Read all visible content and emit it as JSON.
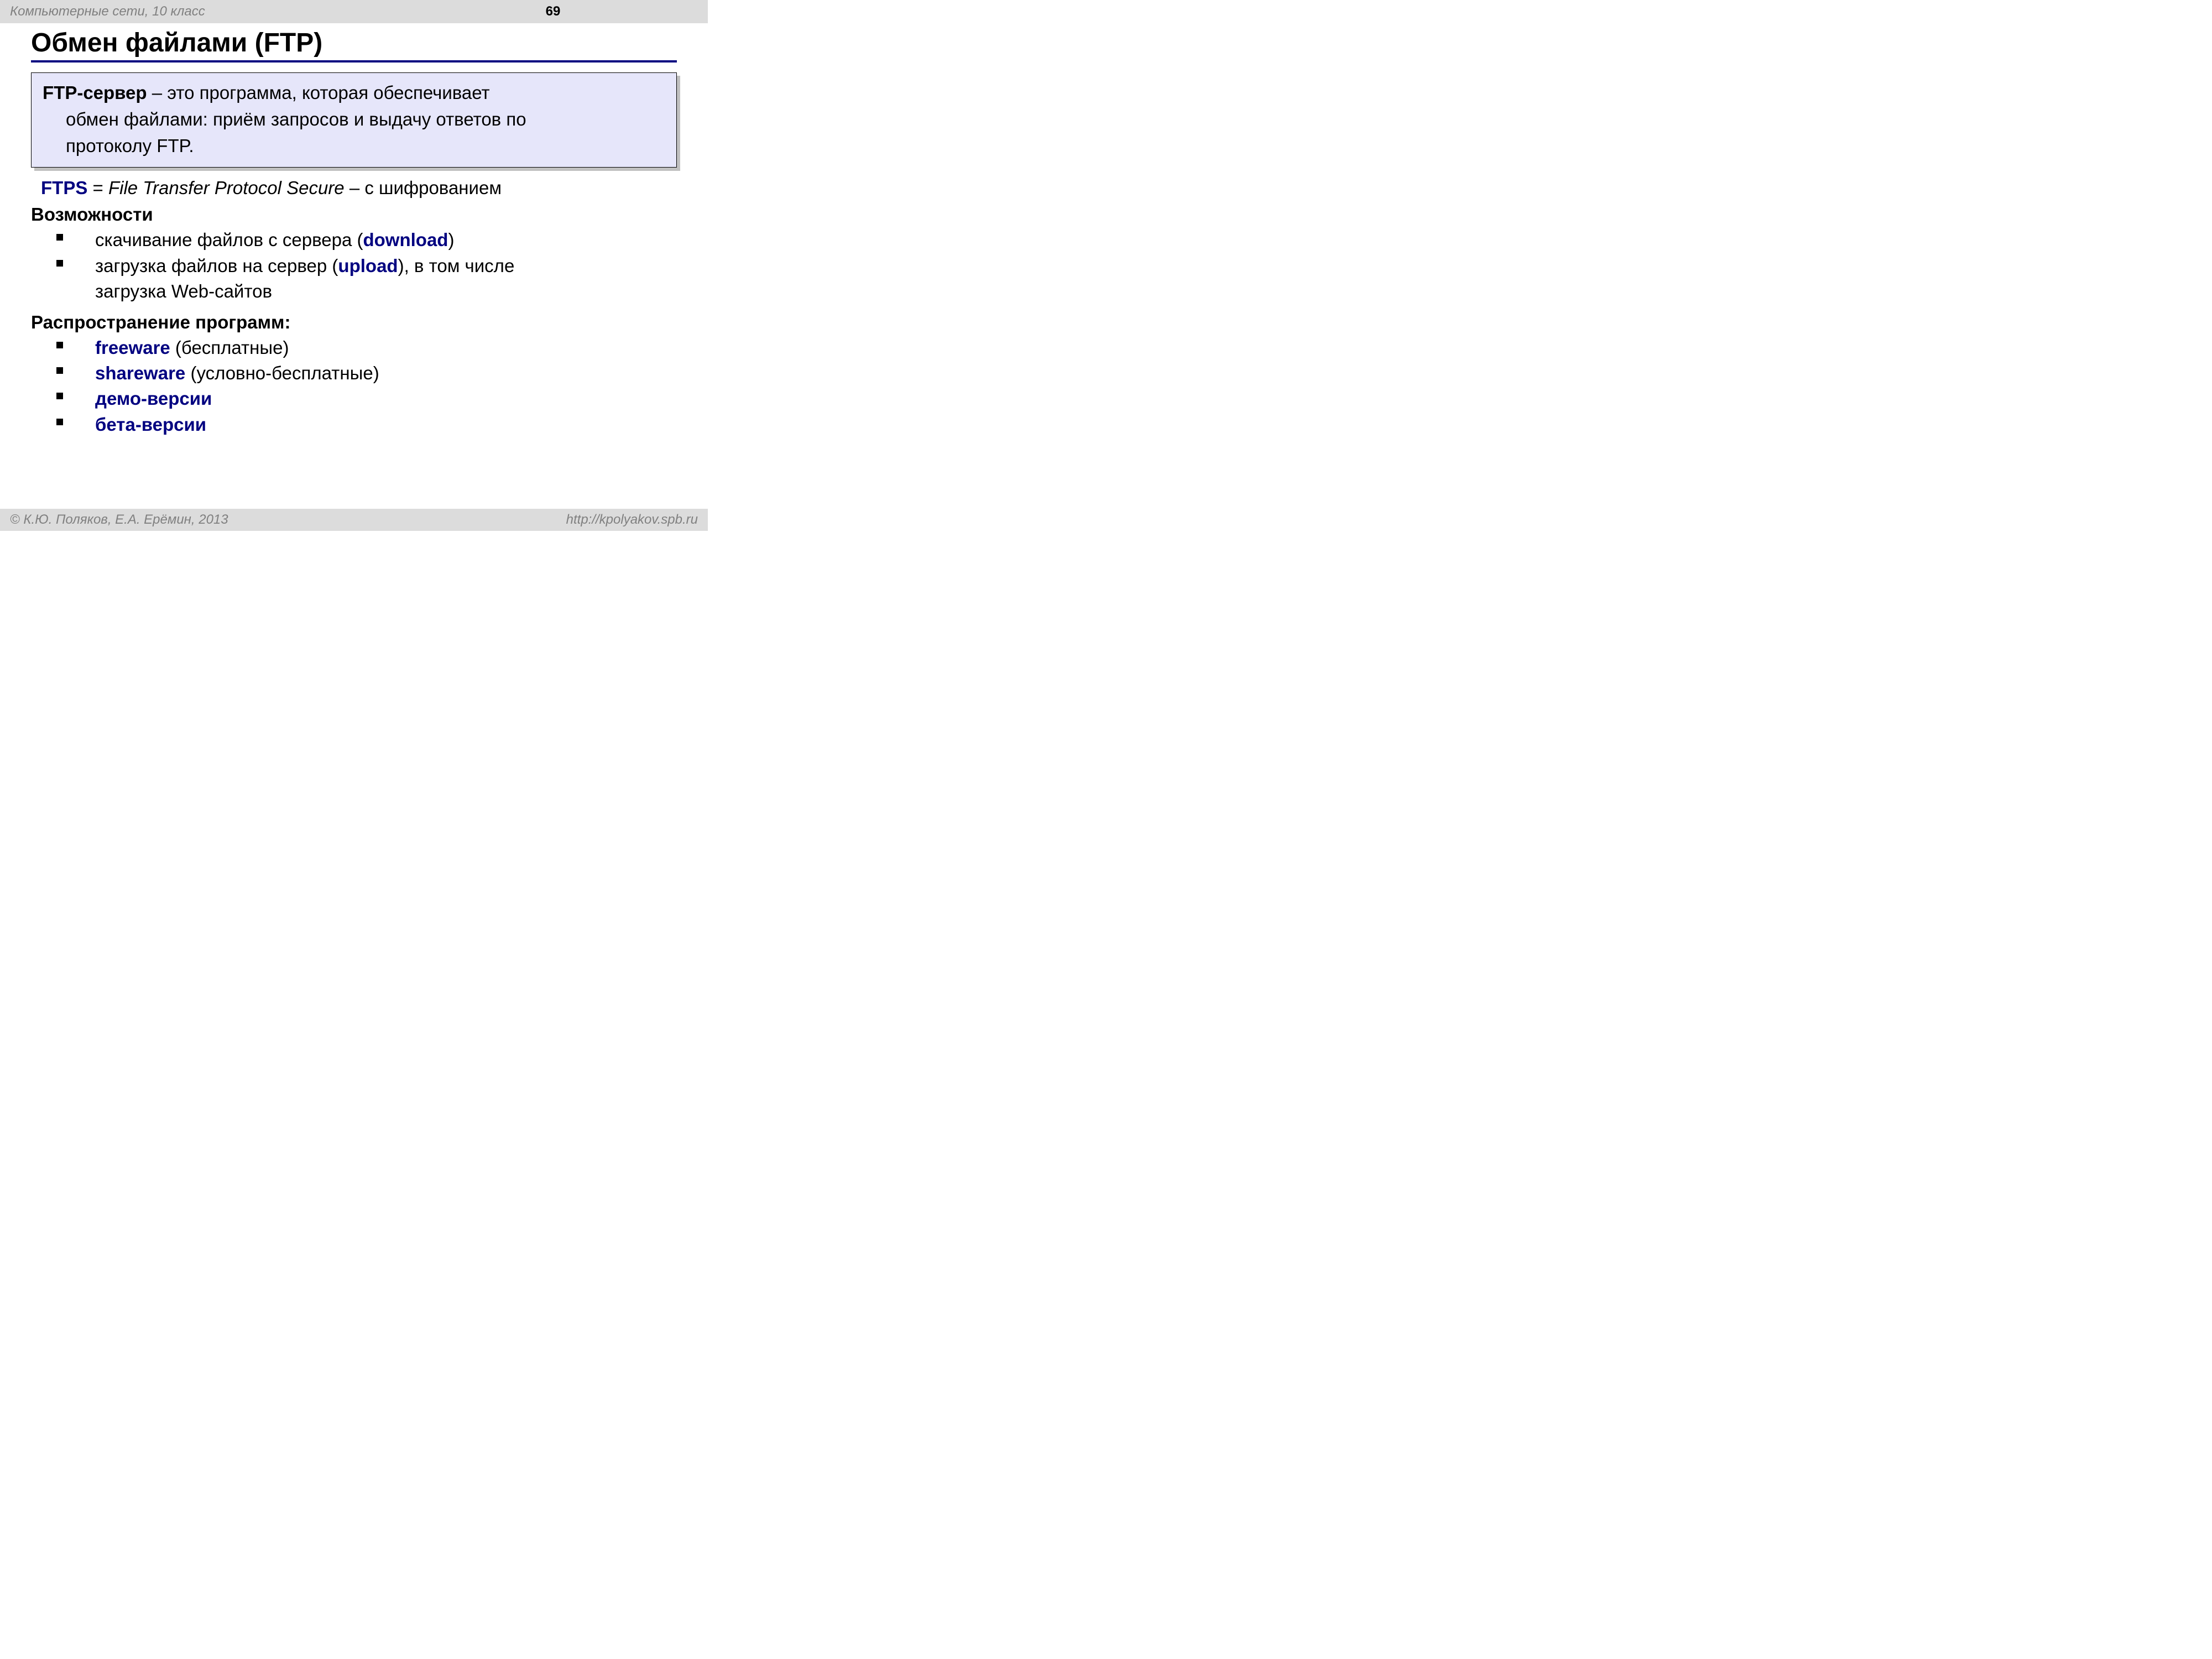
{
  "header": {
    "left": "Компьютерные сети, 10 класс",
    "page": "69"
  },
  "title": "Обмен файлами (FTP)",
  "definition": {
    "term": "FTP-сервер",
    "dash": " – это программа, которая обеспечивает",
    "line2": "обмен файлами: приём запросов и выдачу ответов по",
    "line3": "протоколу FTP."
  },
  "ftps": {
    "label": "FTPS",
    "eq": " = ",
    "expansion": "File Transfer Protocol Secure",
    "tail": " – c шифрованием"
  },
  "sections": {
    "capabilities": {
      "heading": "Возможности",
      "items": [
        {
          "pre": "скачивание файлов c сервера (",
          "kw": "download",
          "post": ")"
        },
        {
          "pre": "загрузка файлов на сервер (",
          "kw": "upload",
          "post": "), в том числе",
          "cont": "загрузка Web-сайтов"
        }
      ]
    },
    "distribution": {
      "heading": "Распространение программ:",
      "items": [
        {
          "kw": "freeware",
          "post": " (бесплатные)"
        },
        {
          "kw": "shareware",
          "post": " (условно-бесплатные)"
        },
        {
          "kw": "демо-версии",
          "post": ""
        },
        {
          "kw": "бета-версии",
          "post": ""
        }
      ]
    }
  },
  "footer": {
    "left": "© К.Ю. Поляков, Е.А. Ерёмин, 2013",
    "right": "http://kpolyakov.spb.ru"
  }
}
